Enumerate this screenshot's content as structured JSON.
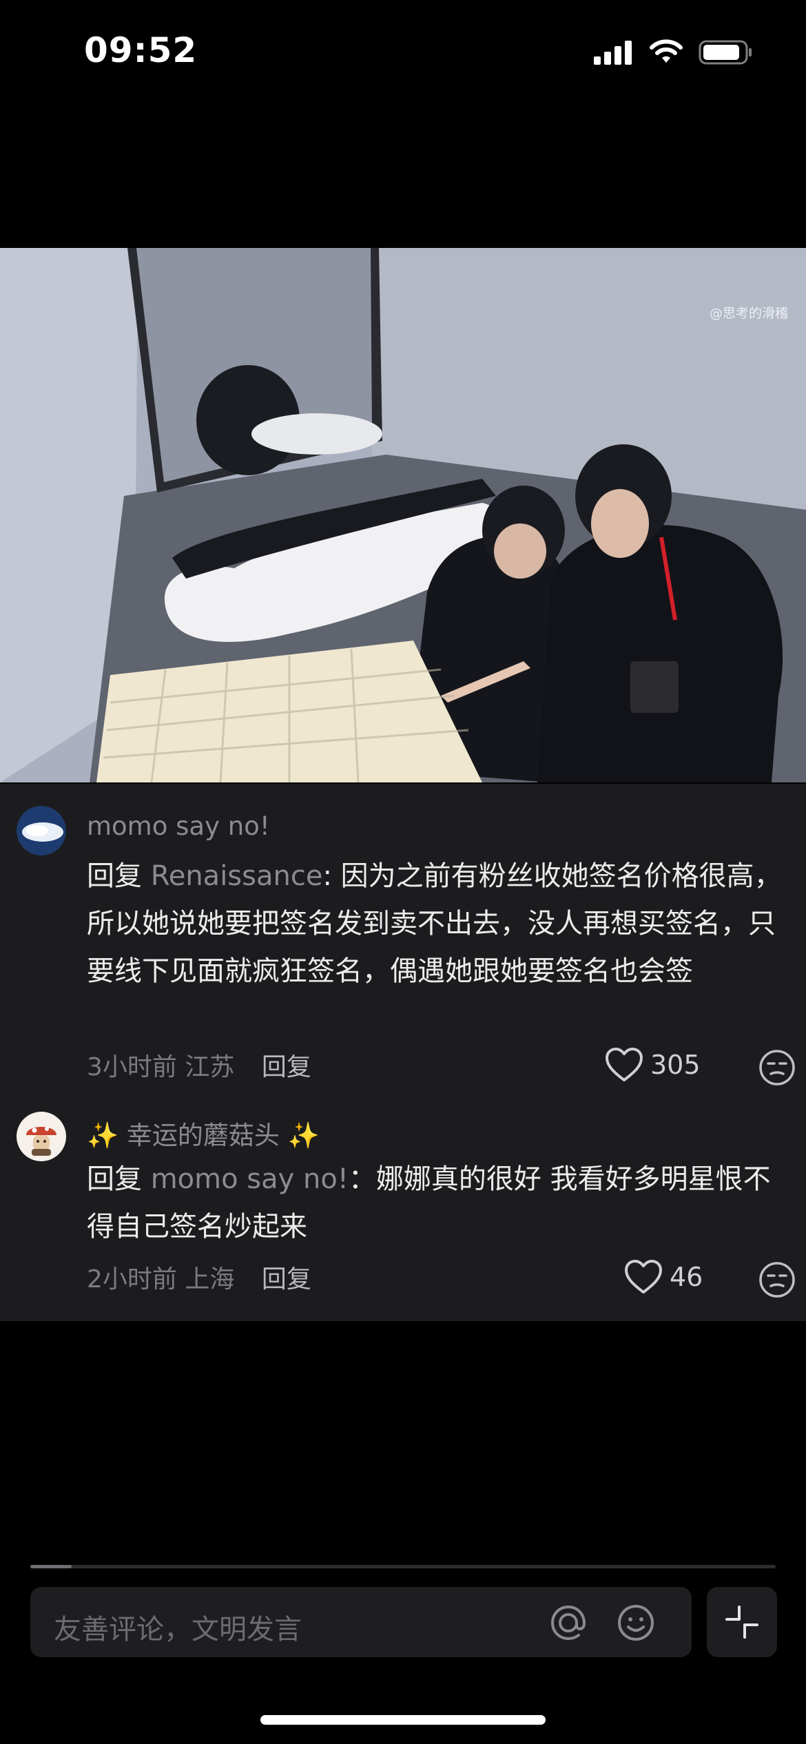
{
  "status_bar": {
    "time": "09:52"
  },
  "video": {
    "watermark": "@思考的滑稽"
  },
  "comments": [
    {
      "username": "momo say no!",
      "reply_prefix": "回复 ",
      "reply_to": "Renaissance",
      "text": ": 因为之前有粉丝收她签名价格很高，所以她说她要把签名发到卖不出去，没人再想买签名，只要线下见面就疯狂签名，偶遇她跟她要签名也会签",
      "time": "3小时前",
      "location": "江苏",
      "reply_label": "回复",
      "likes": "305"
    },
    {
      "username": "✨ 幸运的蘑菇头 ✨",
      "reply_prefix": "回复 ",
      "reply_to": "momo say no!",
      "text": "：娜娜真的很好 我看好多明星恨不得自己签名炒起来",
      "time": "2小时前",
      "location": "上海",
      "reply_label": "回复",
      "likes": "46"
    }
  ],
  "progress": {
    "fraction": 0.055
  },
  "input": {
    "placeholder": "友善评论，文明发言"
  }
}
